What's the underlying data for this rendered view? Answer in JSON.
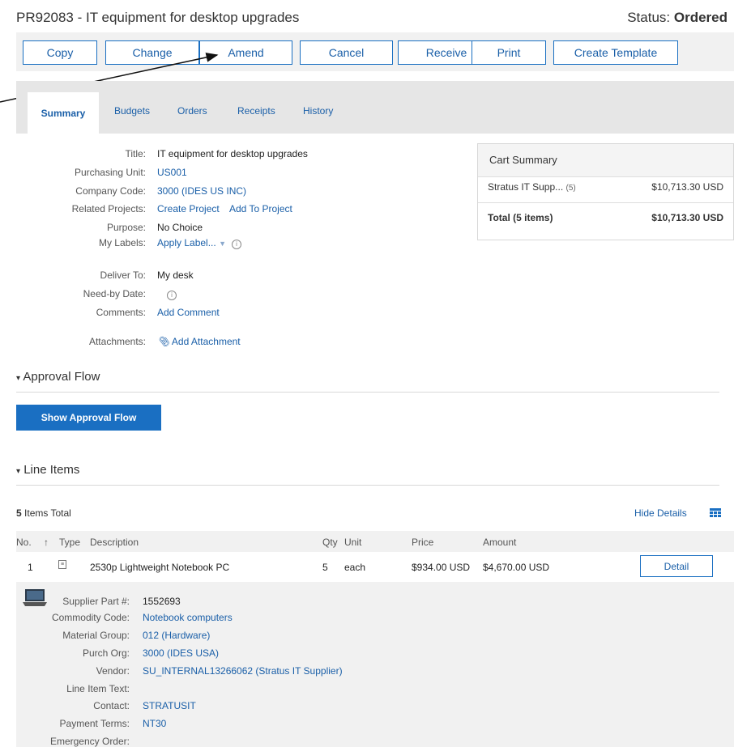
{
  "header": {
    "title": "PR92083 - IT equipment for desktop upgrades",
    "status_label": "Status:",
    "status_value": "Ordered"
  },
  "toolbar": {
    "copy": "Copy",
    "change": "Change",
    "amend": "Amend",
    "cancel": "Cancel",
    "receive": "Receive",
    "print": "Print",
    "create_template": "Create Template"
  },
  "tabs": {
    "summary": "Summary",
    "budgets": "Budgets",
    "orders": "Orders",
    "receipts": "Receipts",
    "history": "History"
  },
  "summary": {
    "title_label": "Title:",
    "title_value": "IT equipment for desktop upgrades",
    "purchasing_unit_label": "Purchasing Unit:",
    "purchasing_unit_value": "US001",
    "company_code_label": "Company Code:",
    "company_code_value": "3000 (IDES US INC)",
    "related_projects_label": "Related Projects:",
    "create_project": "Create Project",
    "add_to_project": "Add To Project",
    "purpose_label": "Purpose:",
    "purpose_value": "No Choice",
    "my_labels_label": "My Labels:",
    "apply_label": "Apply Label...",
    "deliver_to_label": "Deliver To:",
    "deliver_to_value": "My desk",
    "need_by_label": "Need-by Date:",
    "comments_label": "Comments:",
    "add_comment": "Add Comment",
    "attachments_label": "Attachments:",
    "add_attachment": "Add Attachment",
    "info_glyph": "i"
  },
  "cart": {
    "title": "Cart Summary",
    "supplier": "Stratus IT Supp...",
    "supplier_count": "(5)",
    "supplier_amount": "$10,713.30 USD",
    "total_label": "Total (5 items)",
    "total_amount": "$10,713.30 USD"
  },
  "approval": {
    "section_title": "Approval Flow",
    "show_button": "Show Approval Flow"
  },
  "line_items": {
    "section_title": "Line Items",
    "count": "5",
    "count_suffix": "Items Total",
    "hide_details": "Hide Details",
    "columns": {
      "no": "No.",
      "sort_arrow": "↑",
      "type": "Type",
      "description": "Description",
      "qty": "Qty",
      "unit": "Unit",
      "price": "Price",
      "amount": "Amount"
    },
    "rows": [
      {
        "no": "1",
        "description": "2530p Lightweight Notebook PC",
        "qty": "5",
        "unit": "each",
        "price": "$934.00 USD",
        "amount": "$4,670.00 USD",
        "detail_button": "Detail"
      }
    ],
    "details": {
      "supplier_part_label": "Supplier Part #:",
      "supplier_part_value": "1552693",
      "commodity_code_label": "Commodity Code:",
      "commodity_code_value": "Notebook computers",
      "material_group_label": "Material Group:",
      "material_group_value": "012 (Hardware)",
      "purch_org_label": "Purch Org:",
      "purch_org_value": "3000 (IDES USA)",
      "vendor_label": "Vendor:",
      "vendor_value": "SU_INTERNAL13266062 (Stratus IT Supplier)",
      "line_item_text_label": "Line Item Text:",
      "contact_label": "Contact:",
      "contact_value": "STRATUSIT",
      "payment_terms_label": "Payment Terms:",
      "payment_terms_value": "NT30",
      "emergency_order_label": "Emergency Order:"
    }
  }
}
